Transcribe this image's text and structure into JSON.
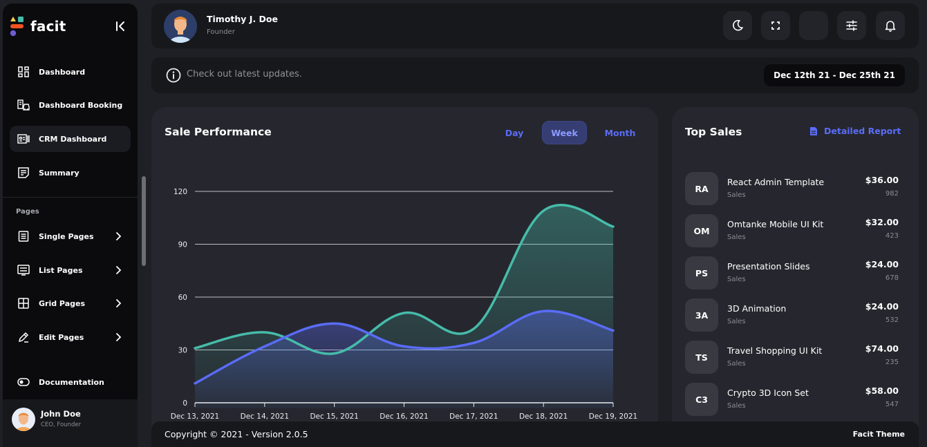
{
  "brand": {
    "name": "facit"
  },
  "sidebar": {
    "items": [
      {
        "label": "Dashboard",
        "icon": "dashboard-icon"
      },
      {
        "label": "Dashboard Booking",
        "icon": "booking-icon"
      },
      {
        "label": "CRM Dashboard",
        "icon": "crm-icon",
        "active": true
      },
      {
        "label": "Summary",
        "icon": "summary-icon"
      }
    ],
    "section_label": "Pages",
    "pages": [
      {
        "label": "Single Pages",
        "icon": "single-pages-icon"
      },
      {
        "label": "List Pages",
        "icon": "list-pages-icon"
      },
      {
        "label": "Grid Pages",
        "icon": "grid-pages-icon"
      },
      {
        "label": "Edit Pages",
        "icon": "edit-pages-icon"
      }
    ],
    "documentation": {
      "label": "Documentation",
      "icon": "toggle-icon"
    },
    "user": {
      "name": "John Doe",
      "role": "CEO, Founder"
    }
  },
  "header": {
    "user_name": "Timothy J. Doe",
    "user_role": "Founder",
    "buttons": [
      "moon-icon",
      "fullscreen-icon",
      "blank-button",
      "sliders-icon",
      "bell-icon"
    ]
  },
  "infobar": {
    "message": "Check out latest updates.",
    "date_range": "Dec 12th 21 - Dec 25th 21"
  },
  "sale_performance": {
    "title": "Sale Performance",
    "tabs": [
      {
        "label": "Day",
        "active": false
      },
      {
        "label": "Week",
        "active": true
      },
      {
        "label": "Month",
        "active": false
      }
    ]
  },
  "chart_data": {
    "type": "area",
    "x": [
      "Dec 13, 2021",
      "Dec 14, 2021",
      "Dec 15, 2021",
      "Dec 16, 2021",
      "Dec 17, 2021",
      "Dec 18, 2021",
      "Dec 19, 2021"
    ],
    "y_ticks": [
      0,
      30,
      60,
      90,
      120
    ],
    "ylim": [
      0,
      120
    ],
    "grid": true,
    "series": [
      {
        "values": [
          31,
          40,
          28,
          51,
          42,
          109,
          100
        ],
        "color": "#46bcaa"
      },
      {
        "values": [
          11,
          32,
          45,
          32,
          34,
          52,
          41
        ],
        "color": "#5a6cf7"
      }
    ]
  },
  "top_sales": {
    "title": "Top Sales",
    "report_link": "Detailed Report",
    "items": [
      {
        "code": "RA",
        "name": "React Admin Template",
        "sub": "Sales",
        "price": "$36.00",
        "count": "982"
      },
      {
        "code": "OM",
        "name": "Omtanke Mobile UI Kit",
        "sub": "Sales",
        "price": "$32.00",
        "count": "423"
      },
      {
        "code": "PS",
        "name": "Presentation Slides",
        "sub": "Sales",
        "price": "$24.00",
        "count": "678"
      },
      {
        "code": "3A",
        "name": "3D Animation",
        "sub": "Sales",
        "price": "$24.00",
        "count": "532"
      },
      {
        "code": "TS",
        "name": "Travel Shopping UI Kit",
        "sub": "Sales",
        "price": "$74.00",
        "count": "235"
      },
      {
        "code": "C3",
        "name": "Crypto 3D Icon Set",
        "sub": "Sales",
        "price": "$58.00",
        "count": "547"
      }
    ]
  },
  "footer": {
    "copyright": "Copyright © 2021 - Version 2.0.5",
    "theme": "Facit Theme"
  },
  "colors": {
    "accent": "#5a6cf7",
    "teal": "#46bcaa",
    "card": "#26272e",
    "panel": "#17181c",
    "sidebar": "#0b0b0d"
  }
}
